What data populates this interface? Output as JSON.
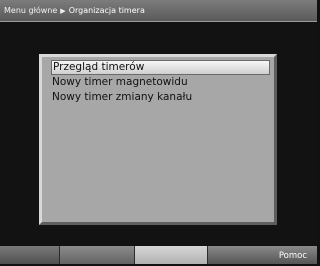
{
  "header": {
    "breadcrumb_root": "Menu główne",
    "separator": "▶",
    "breadcrumb_current": "Organizacja timera"
  },
  "menu": {
    "items": [
      {
        "label": "Przegląd timerów",
        "selected": true
      },
      {
        "label": "Nowy timer magnetowidu",
        "selected": false
      },
      {
        "label": "Nowy timer zmiany kanału",
        "selected": false
      }
    ]
  },
  "footer": {
    "help_label": "Pomoc"
  }
}
